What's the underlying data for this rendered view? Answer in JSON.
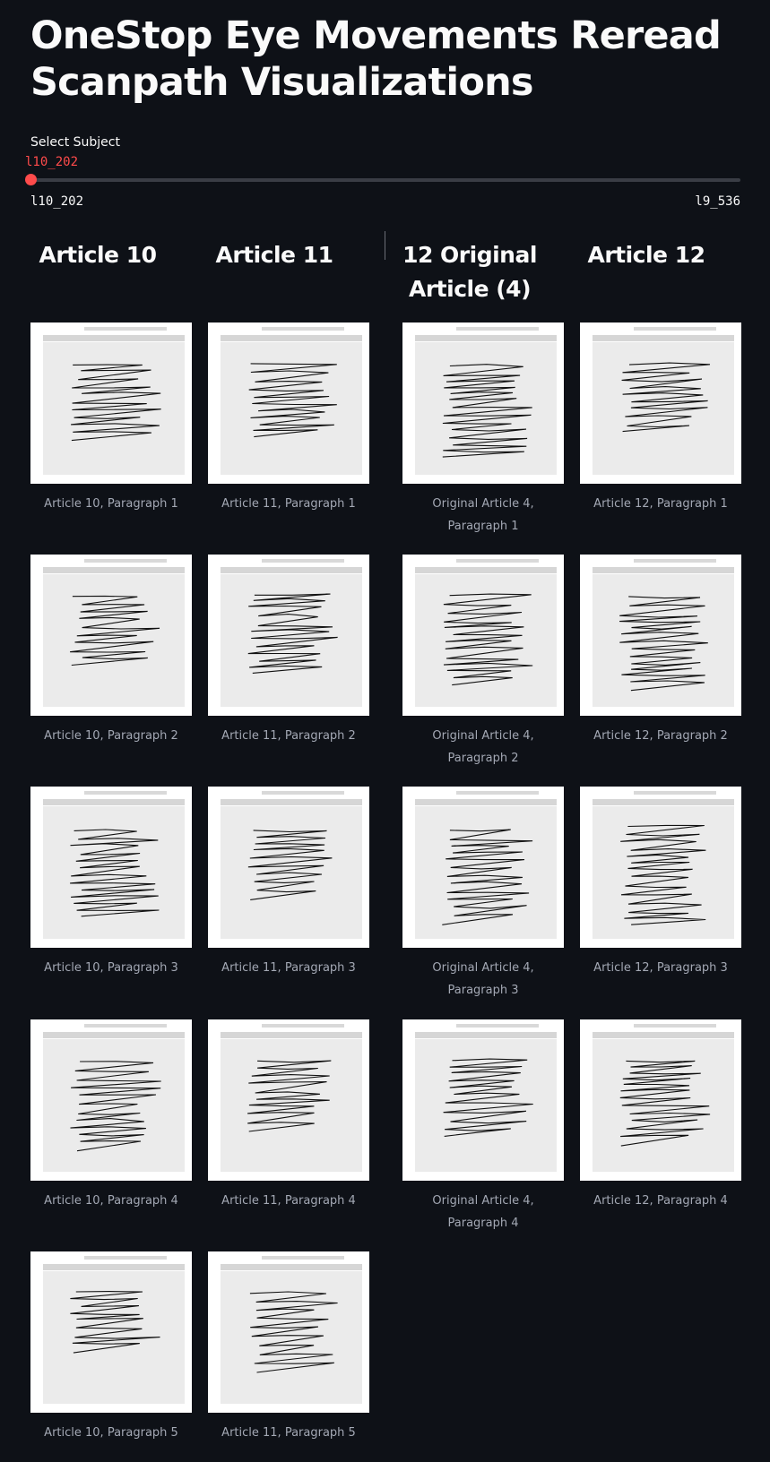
{
  "title": "OneStop Eye Movements Reread Scanpath Visualizations",
  "slider": {
    "label": "Select Subject",
    "value": "l10_202",
    "min_label": "l10_202",
    "max_label": "l9_536",
    "accent": "#ff4b4b",
    "position": 0
  },
  "columns": [
    {
      "header": "Article 10",
      "items": [
        {
          "caption": "Article 10, Paragraph 1"
        },
        {
          "caption": "Article 10, Paragraph 2"
        },
        {
          "caption": "Article 10, Paragraph 3"
        },
        {
          "caption": "Article 10, Paragraph 4"
        },
        {
          "caption": "Article 10, Paragraph 5"
        }
      ]
    },
    {
      "header": "Article 11",
      "items": [
        {
          "caption": "Article 11, Paragraph 1"
        },
        {
          "caption": "Article 11, Paragraph 2"
        },
        {
          "caption": "Article 11, Paragraph 3"
        },
        {
          "caption": "Article 11, Paragraph 4"
        },
        {
          "caption": "Article 11, Paragraph 5"
        }
      ]
    },
    {
      "header": "12 Original Article (4)",
      "items": [
        {
          "caption": "Original Article 4, Paragraph 1"
        },
        {
          "caption": "Original Article 4, Paragraph 2"
        },
        {
          "caption": "Original Article 4, Paragraph 3"
        },
        {
          "caption": "Original Article 4, Paragraph 4"
        }
      ]
    },
    {
      "header": "Article 12",
      "items": [
        {
          "caption": "Article 12, Paragraph 1"
        },
        {
          "caption": "Article 12, Paragraph 2"
        },
        {
          "caption": "Article 12, Paragraph 3"
        },
        {
          "caption": "Article 12, Paragraph 4"
        }
      ]
    }
  ],
  "colors": {
    "background": "#0e1117",
    "text": "#fafafa",
    "caption": "#a3a8b4",
    "plot_panel": "#ebebeb"
  }
}
